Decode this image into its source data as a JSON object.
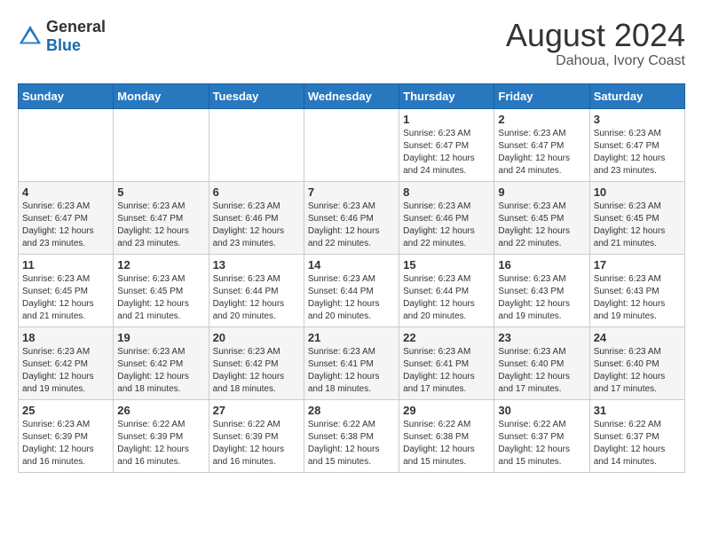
{
  "header": {
    "logo_general": "General",
    "logo_blue": "Blue",
    "month_year": "August 2024",
    "location": "Dahoua, Ivory Coast"
  },
  "days_of_week": [
    "Sunday",
    "Monday",
    "Tuesday",
    "Wednesday",
    "Thursday",
    "Friday",
    "Saturday"
  ],
  "weeks": [
    [
      {
        "day": "",
        "info": ""
      },
      {
        "day": "",
        "info": ""
      },
      {
        "day": "",
        "info": ""
      },
      {
        "day": "",
        "info": ""
      },
      {
        "day": "1",
        "info": "Sunrise: 6:23 AM\nSunset: 6:47 PM\nDaylight: 12 hours\nand 24 minutes."
      },
      {
        "day": "2",
        "info": "Sunrise: 6:23 AM\nSunset: 6:47 PM\nDaylight: 12 hours\nand 24 minutes."
      },
      {
        "day": "3",
        "info": "Sunrise: 6:23 AM\nSunset: 6:47 PM\nDaylight: 12 hours\nand 23 minutes."
      }
    ],
    [
      {
        "day": "4",
        "info": "Sunrise: 6:23 AM\nSunset: 6:47 PM\nDaylight: 12 hours\nand 23 minutes."
      },
      {
        "day": "5",
        "info": "Sunrise: 6:23 AM\nSunset: 6:47 PM\nDaylight: 12 hours\nand 23 minutes."
      },
      {
        "day": "6",
        "info": "Sunrise: 6:23 AM\nSunset: 6:46 PM\nDaylight: 12 hours\nand 23 minutes."
      },
      {
        "day": "7",
        "info": "Sunrise: 6:23 AM\nSunset: 6:46 PM\nDaylight: 12 hours\nand 22 minutes."
      },
      {
        "day": "8",
        "info": "Sunrise: 6:23 AM\nSunset: 6:46 PM\nDaylight: 12 hours\nand 22 minutes."
      },
      {
        "day": "9",
        "info": "Sunrise: 6:23 AM\nSunset: 6:45 PM\nDaylight: 12 hours\nand 22 minutes."
      },
      {
        "day": "10",
        "info": "Sunrise: 6:23 AM\nSunset: 6:45 PM\nDaylight: 12 hours\nand 21 minutes."
      }
    ],
    [
      {
        "day": "11",
        "info": "Sunrise: 6:23 AM\nSunset: 6:45 PM\nDaylight: 12 hours\nand 21 minutes."
      },
      {
        "day": "12",
        "info": "Sunrise: 6:23 AM\nSunset: 6:45 PM\nDaylight: 12 hours\nand 21 minutes."
      },
      {
        "day": "13",
        "info": "Sunrise: 6:23 AM\nSunset: 6:44 PM\nDaylight: 12 hours\nand 20 minutes."
      },
      {
        "day": "14",
        "info": "Sunrise: 6:23 AM\nSunset: 6:44 PM\nDaylight: 12 hours\nand 20 minutes."
      },
      {
        "day": "15",
        "info": "Sunrise: 6:23 AM\nSunset: 6:44 PM\nDaylight: 12 hours\nand 20 minutes."
      },
      {
        "day": "16",
        "info": "Sunrise: 6:23 AM\nSunset: 6:43 PM\nDaylight: 12 hours\nand 19 minutes."
      },
      {
        "day": "17",
        "info": "Sunrise: 6:23 AM\nSunset: 6:43 PM\nDaylight: 12 hours\nand 19 minutes."
      }
    ],
    [
      {
        "day": "18",
        "info": "Sunrise: 6:23 AM\nSunset: 6:42 PM\nDaylight: 12 hours\nand 19 minutes."
      },
      {
        "day": "19",
        "info": "Sunrise: 6:23 AM\nSunset: 6:42 PM\nDaylight: 12 hours\nand 18 minutes."
      },
      {
        "day": "20",
        "info": "Sunrise: 6:23 AM\nSunset: 6:42 PM\nDaylight: 12 hours\nand 18 minutes."
      },
      {
        "day": "21",
        "info": "Sunrise: 6:23 AM\nSunset: 6:41 PM\nDaylight: 12 hours\nand 18 minutes."
      },
      {
        "day": "22",
        "info": "Sunrise: 6:23 AM\nSunset: 6:41 PM\nDaylight: 12 hours\nand 17 minutes."
      },
      {
        "day": "23",
        "info": "Sunrise: 6:23 AM\nSunset: 6:40 PM\nDaylight: 12 hours\nand 17 minutes."
      },
      {
        "day": "24",
        "info": "Sunrise: 6:23 AM\nSunset: 6:40 PM\nDaylight: 12 hours\nand 17 minutes."
      }
    ],
    [
      {
        "day": "25",
        "info": "Sunrise: 6:23 AM\nSunset: 6:39 PM\nDaylight: 12 hours\nand 16 minutes."
      },
      {
        "day": "26",
        "info": "Sunrise: 6:22 AM\nSunset: 6:39 PM\nDaylight: 12 hours\nand 16 minutes."
      },
      {
        "day": "27",
        "info": "Sunrise: 6:22 AM\nSunset: 6:39 PM\nDaylight: 12 hours\nand 16 minutes."
      },
      {
        "day": "28",
        "info": "Sunrise: 6:22 AM\nSunset: 6:38 PM\nDaylight: 12 hours\nand 15 minutes."
      },
      {
        "day": "29",
        "info": "Sunrise: 6:22 AM\nSunset: 6:38 PM\nDaylight: 12 hours\nand 15 minutes."
      },
      {
        "day": "30",
        "info": "Sunrise: 6:22 AM\nSunset: 6:37 PM\nDaylight: 12 hours\nand 15 minutes."
      },
      {
        "day": "31",
        "info": "Sunrise: 6:22 AM\nSunset: 6:37 PM\nDaylight: 12 hours\nand 14 minutes."
      }
    ]
  ]
}
